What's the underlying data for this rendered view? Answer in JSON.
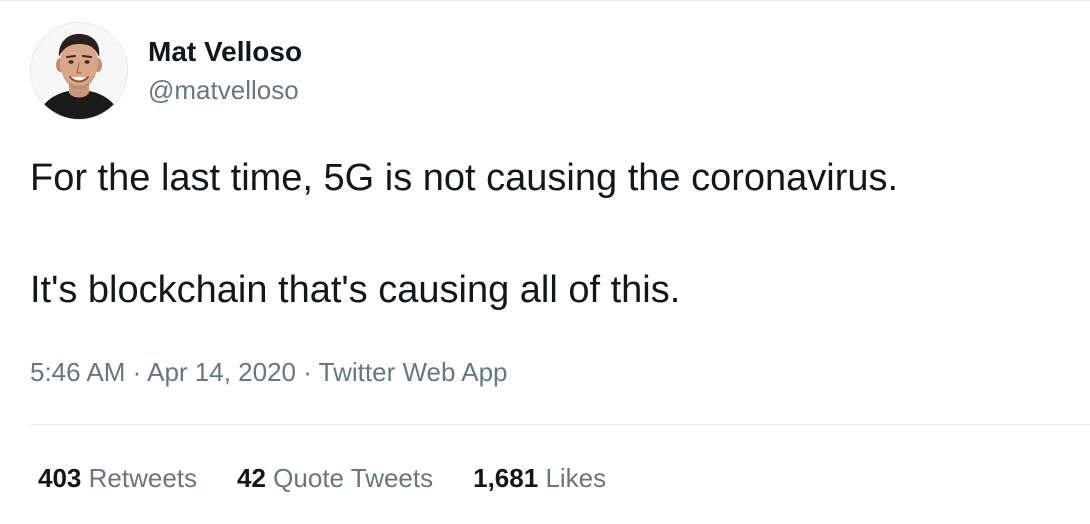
{
  "tweet": {
    "author": {
      "display_name": "Mat Velloso",
      "handle": "@matvelloso",
      "avatar_icon": "profile-photo"
    },
    "text_lines": [
      "For the last time, 5G is not causing the coronavirus.",
      "It's blockchain that's causing all of this."
    ],
    "meta": {
      "time": "5:46 AM",
      "separator": "·",
      "date": "Apr 14, 2020",
      "source": "Twitter Web App"
    },
    "stats": {
      "retweets_count": "403",
      "retweets_label": "Retweets",
      "quotes_count": "42",
      "quotes_label": "Quote Tweets",
      "likes_count": "1,681",
      "likes_label": "Likes"
    }
  },
  "colors": {
    "text_primary": "#14171a",
    "text_secondary": "#657786",
    "divider": "#e6ecf0",
    "background": "#ffffff"
  }
}
